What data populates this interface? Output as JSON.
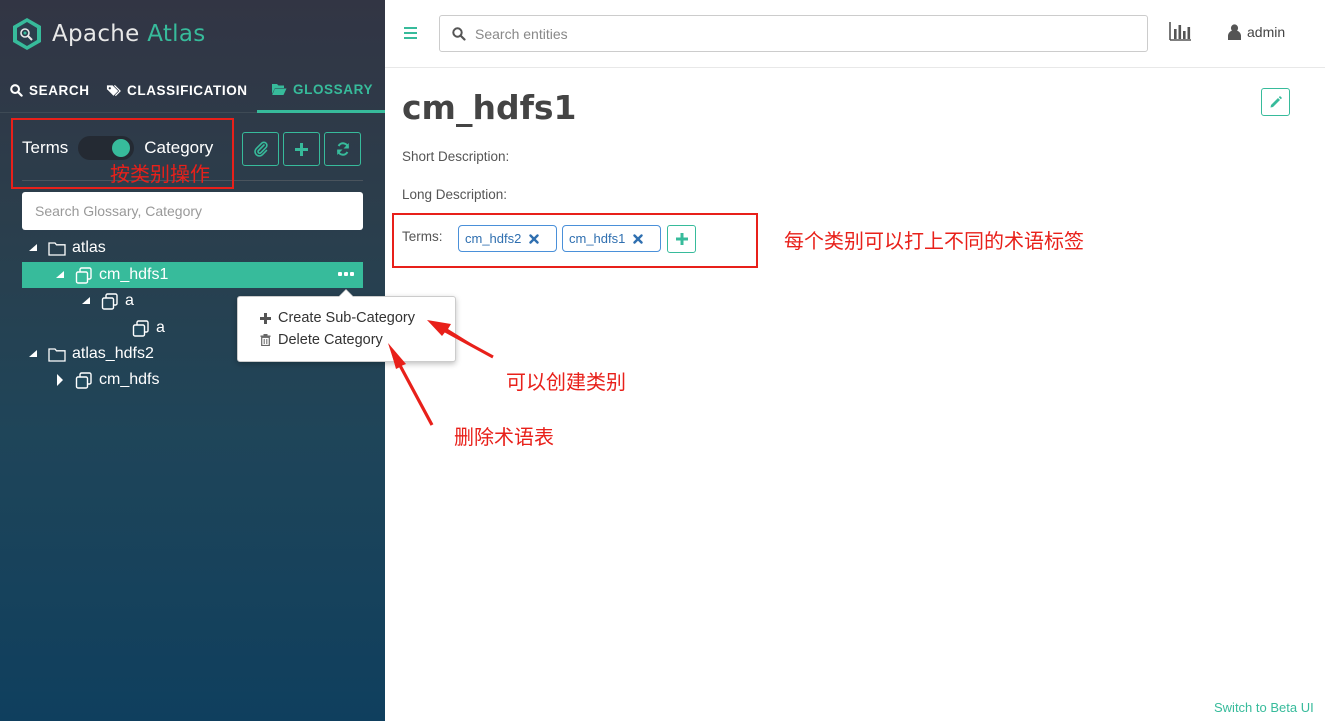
{
  "app": {
    "logo_word1": "Apache",
    "logo_word2": "Atlas",
    "accent_color": "#37bb9b"
  },
  "sidebar": {
    "tabs": [
      {
        "label": "SEARCH",
        "icon": "search-icon"
      },
      {
        "label": "CLASSIFICATION",
        "icon": "tag-icon"
      },
      {
        "label": "GLOSSARY",
        "icon": "folder-open-icon",
        "active": true
      }
    ],
    "toggle": {
      "left_label": "Terms",
      "right_label": "Category",
      "state": "Category"
    },
    "action_icons": [
      "paperclip-icon",
      "plus-icon",
      "refresh-icon"
    ],
    "search_placeholder": "Search Glossary, Category",
    "tree": [
      {
        "label": "atlas",
        "level": 0,
        "expanded": true,
        "type": "glossary"
      },
      {
        "label": "cm_hdfs1",
        "level": 1,
        "expanded": true,
        "type": "category",
        "selected": true
      },
      {
        "label": "a",
        "level": 2,
        "expanded": true,
        "type": "category"
      },
      {
        "label": "a",
        "level": 3,
        "type": "category"
      },
      {
        "label": "atlas_hdfs2",
        "level": 0,
        "expanded": true,
        "type": "glossary"
      },
      {
        "label": "cm_hdfs",
        "level": 1,
        "expanded": false,
        "type": "category"
      }
    ]
  },
  "context_menu": {
    "items": [
      {
        "label": "Create Sub-Category",
        "icon": "plus-icon"
      },
      {
        "label": "Delete Category",
        "icon": "trash-icon"
      }
    ]
  },
  "topbar": {
    "search_placeholder": "Search entities",
    "user": "admin"
  },
  "main": {
    "title": "cm_hdfs1",
    "short_description_label": "Short Description:",
    "long_description_label": "Long Description:",
    "terms_label": "Terms:",
    "terms": [
      "cm_hdfs2",
      "cm_hdfs1"
    ]
  },
  "footer": {
    "beta_link": "Switch to Beta UI"
  },
  "annotations": {
    "color": "#e8201a",
    "texts": [
      "按类别操作",
      "每个类别可以打上不同的术语标签",
      "可以创建类别",
      "删除术语表"
    ]
  }
}
